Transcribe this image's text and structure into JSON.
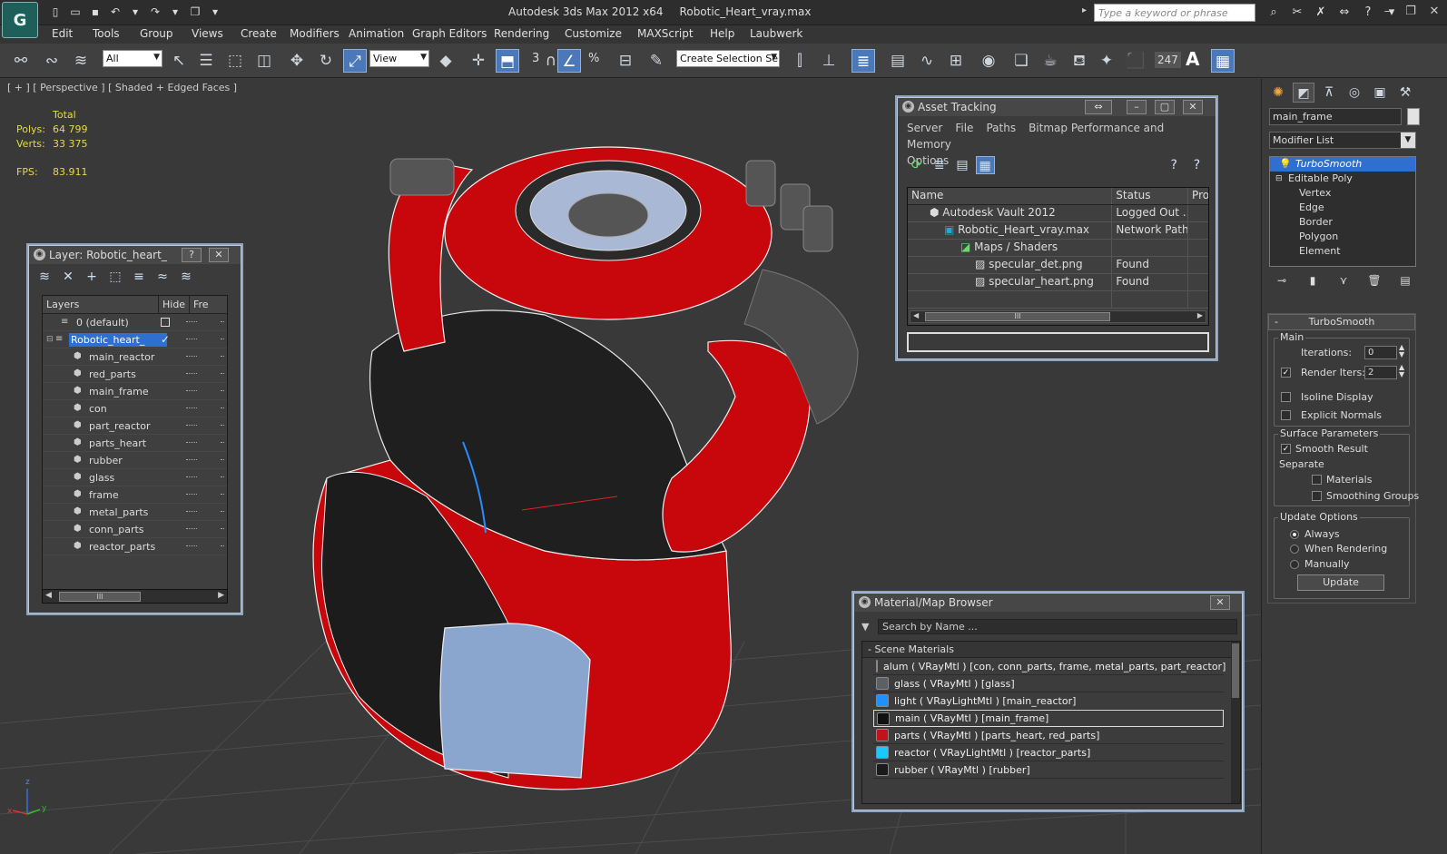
{
  "app": {
    "title": "Autodesk 3ds Max  2012 x64",
    "file": "Robotic_Heart_vray.max",
    "logo_text": "G",
    "search_placeholder": "Type a keyword or phrase"
  },
  "menubar": [
    "Edit",
    "Tools",
    "Group",
    "Views",
    "Create",
    "Modifiers",
    "Animation",
    "Graph Editors",
    "Rendering",
    "Customize",
    "MAXScript",
    "Help",
    "Laubwerk"
  ],
  "toolbar": {
    "selection_filter": "All",
    "ref_coord": "View",
    "snap_value": "3",
    "named_selection": "Create Selection Se",
    "percent_snap": "%",
    "count_badge": "247",
    "text_icon": "A"
  },
  "viewport": {
    "label": "[ + ] [ Perspective ] [ Shaded + Edged Faces ]",
    "stats": {
      "header": "Total",
      "polys_label": "Polys:",
      "polys": "64 799",
      "verts_label": "Verts:",
      "verts": "33 375",
      "fps_label": "FPS:",
      "fps": "83.911"
    },
    "axis_z": "z",
    "axis_x": "x",
    "axis_y": "y"
  },
  "layer_panel": {
    "title": "Layer: Robotic_heart_",
    "help": "?",
    "col_layers": "Layers",
    "col_hide": "Hide",
    "col_freeze": "Fre",
    "rows": [
      {
        "name": "0 (default)"
      },
      {
        "name": "Robotic_heart_"
      },
      {
        "name": "main_reactor"
      },
      {
        "name": "red_parts"
      },
      {
        "name": "main_frame"
      },
      {
        "name": "con"
      },
      {
        "name": "part_reactor"
      },
      {
        "name": "parts_heart"
      },
      {
        "name": "rubber"
      },
      {
        "name": "glass"
      },
      {
        "name": "frame"
      },
      {
        "name": "metal_parts"
      },
      {
        "name": "conn_parts"
      },
      {
        "name": "reactor_parts"
      }
    ],
    "scroll_thumb": "III"
  },
  "asset_panel": {
    "title": "Asset Tracking",
    "menu": [
      "Server",
      "File",
      "Paths",
      "Bitmap Performance and Memory",
      "Options"
    ],
    "col_name": "Name",
    "col_status": "Status",
    "col_pro": "Pro",
    "rows": [
      {
        "name": "Autodesk Vault 2012",
        "status": "Logged Out ..."
      },
      {
        "name": "Robotic_Heart_vray.max",
        "status": "Network Path"
      },
      {
        "name": "Maps / Shaders",
        "status": ""
      },
      {
        "name": "specular_det.png",
        "status": "Found"
      },
      {
        "name": "specular_heart.png",
        "status": "Found"
      }
    ],
    "scroll_thumb": "III"
  },
  "material_panel": {
    "title": "Material/Map Browser",
    "search": "Search by Name ...",
    "group": "Scene Materials",
    "rows": [
      {
        "text": "alum  ( VRayMtl ) [con, conn_parts, frame, metal_parts, part_reactor]",
        "color": "#8a8f96"
      },
      {
        "text": "glass  ( VRayMtl ) [glass]",
        "color": "#5b6066"
      },
      {
        "text": "light  ( VRayLightMtl ) [main_reactor]",
        "color": "#1e90ff"
      },
      {
        "text": "main  ( VRayMtl ) [main_frame]",
        "color": "#111111"
      },
      {
        "text": "parts  ( VRayMtl ) [parts_heart, red_parts]",
        "color": "#c0141a"
      },
      {
        "text": "reactor  ( VRayLightMtl ) [reactor_parts]",
        "color": "#19c8ff"
      },
      {
        "text": "rubber  ( VRayMtl ) [rubber]",
        "color": "#1a1a1a"
      }
    ]
  },
  "command_panel": {
    "object_name": "main_frame",
    "modifier_list": "Modifier List",
    "stack": [
      "TurboSmooth",
      "Editable Poly",
      "Vertex",
      "Edge",
      "Border",
      "Polygon",
      "Element"
    ],
    "rollout_title": "TurboSmooth",
    "main_group": "Main",
    "iterations_label": "Iterations:",
    "iterations": "0",
    "render_iters_label": "Render Iters:",
    "render_iters": "2",
    "isoline": "Isoline Display",
    "explicit_normals": "Explicit Normals",
    "surface_group": "Surface Parameters",
    "smooth_result": "Smooth Result",
    "separate": "Separate",
    "materials": "Materials",
    "smoothing_groups": "Smoothing Groups",
    "update_group": "Update Options",
    "always": "Always",
    "when_rendering": "When Rendering",
    "manually": "Manually",
    "update_btn": "Update"
  },
  "colors": {
    "accent": "#2f6fd0",
    "model_red": "#c8070d",
    "stats": "#e6d84a"
  }
}
